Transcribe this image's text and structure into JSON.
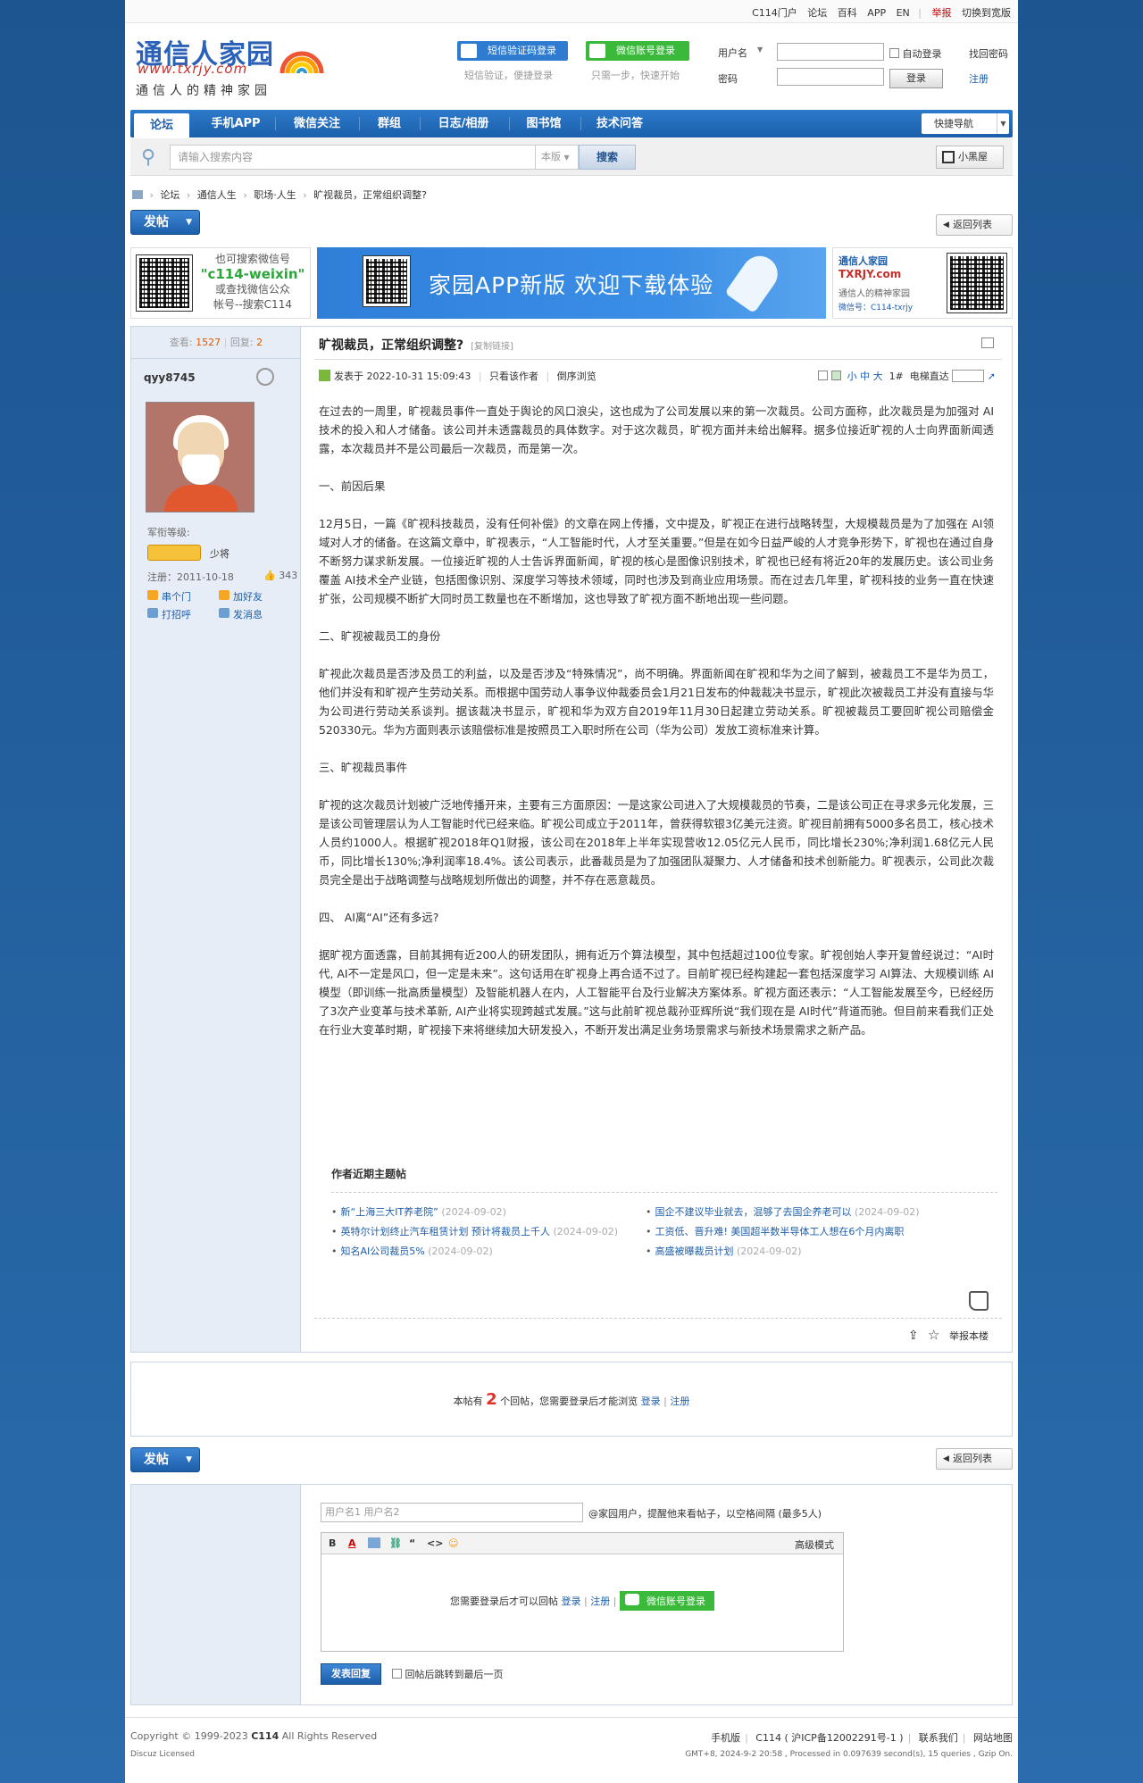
{
  "topbar": {
    "links": [
      "C114门户",
      "论坛",
      "百科",
      "APP",
      "EN"
    ],
    "report": "举报",
    "switch_width": "切换到宽版"
  },
  "header": {
    "logo_title": "通信人家园",
    "logo_url": "www.txrjy.com",
    "logo_slogan": "通信人的精神家园",
    "sms_login": "短信验证码登录",
    "sms_hint": "短信验证，便捷登录",
    "wechat_login": "微信账号登录",
    "wechat_hint": "只需一步，快速开始",
    "username_label": "用户名",
    "password_label": "密码",
    "auto_login": "自动登录",
    "find_password": "找回密码",
    "login_button": "登录",
    "register": "注册"
  },
  "nav": {
    "items": [
      "论坛",
      "手机APP",
      "微信关注",
      "群组",
      "日志/相册",
      "图书馆",
      "技术问答"
    ],
    "quick_nav": "快捷导航"
  },
  "search": {
    "placeholder": "请输入搜索内容",
    "scope": "本版",
    "button": "搜索",
    "black_room": "小黑屋"
  },
  "breadcrumb": [
    "论坛",
    "通信人生",
    "职场·人生",
    "旷视裁员，正常组织调整?"
  ],
  "actions": {
    "post": "发帖",
    "back_to_list": "返回列表"
  },
  "banner": {
    "wx_line1": "也可搜索微信号",
    "wx_id": "\"c114-weixin\"",
    "wx_line3": "或查找微信公众",
    "wx_line4": "帐号--搜索C114",
    "app_text": "家园APP新版 欢迎下载体验",
    "right_title": "通信人家园",
    "right_brand": "TXRJY.com",
    "right_slogan": "通信人的精神家园",
    "right_wechat": "微信号：C114-txrjy"
  },
  "post": {
    "views_label": "查看:",
    "views": "1527",
    "replies_label": "回复:",
    "replies": "2",
    "title": "旷视裁员，正常组织调整?",
    "copy_link": "[复制链接]",
    "author": "qyy8745",
    "rank_label": "军衔等级:",
    "rank": "少将",
    "reg_date": "注册：2011-10-18",
    "likes": "343",
    "user_actions": [
      "串个门",
      "加好友",
      "打招呼",
      "发消息"
    ],
    "posted_at": "发表于 2022-10-31 15:09:43",
    "only_author": "只看该作者",
    "reverse": "倒序浏览",
    "font_sizes": [
      "小",
      "中",
      "大"
    ],
    "floor": "1#",
    "elevator": "电梯直达",
    "paragraphs": [
      "在过去的一周里，旷视裁员事件一直处于舆论的风口浪尖，这也成为了公司发展以来的第一次裁员。公司方面称，此次裁员是为加强对 AI技术的投入和人才储备。该公司并未透露裁员的具体数字。对于这次裁员，旷视方面并未给出解释。据多位接近旷视的人士向界面新闻透露，本次裁员并不是公司最后一次裁员，而是第一次。",
      "一、前因后果",
      "12月5日，一篇《旷视科技裁员，没有任何补偿》的文章在网上传播，文中提及，旷视正在进行战略转型，大规模裁员是为了加强在 AI领域对人才的储备。在这篇文章中，旷视表示，“人工智能时代，人才至关重要。”但是在如今日益严峻的人才竞争形势下，旷视也在通过自身不断努力谋求新发展。一位接近旷视的人士告诉界面新闻，旷视的核心是图像识别技术，旷视也已经有将近20年的发展历史。该公司业务覆盖 AI技术全产业链，包括图像识别、深度学习等技术领域，同时也涉及到商业应用场景。而在过去几年里，旷视科技的业务一直在快速扩张，公司规模不断扩大同时员工数量也在不断增加，这也导致了旷视方面不断地出现一些问题。",
      "二、旷视被裁员工的身份",
      "旷视此次裁员是否涉及员工的利益，以及是否涉及“特殊情况”，尚不明确。界面新闻在旷视和华为之间了解到，被裁员工不是华为员工，他们并没有和旷视产生劳动关系。而根据中国劳动人事争议仲裁委员会1月21日发布的仲裁裁决书显示，旷视此次被裁员工并没有直接与华为公司进行劳动关系谈判。据该裁决书显示，旷视和华为双方自2019年11月30日起建立劳动关系。旷视被裁员工要回旷视公司赔偿金520330元。华为方面则表示该赔偿标准是按照员工入职时所在公司（华为公司）发放工资标准来计算。",
      "三、旷视裁员事件",
      "旷视的这次裁员计划被广泛地传播开来，主要有三方面原因：一是这家公司进入了大规模裁员的节奏，二是该公司正在寻求多元化发展，三是该公司管理层认为人工智能时代已经来临。旷视公司成立于2011年，曾获得软银3亿美元注资。旷视目前拥有5000多名员工，核心技术人员约1000人。根据旷视2018年Q1财报，该公司在2018年上半年实现营收12.05亿元人民币，同比增长230%;净利润1.68亿元人民币，同比增长130%;净利润率18.4%。该公司表示，此番裁员是为了加强团队凝聚力、人才储备和技术创新能力。旷视表示，公司此次裁员完全是出于战略调整与战略规划所做出的调整，并不存在恶意裁员。",
      "四、 AI离“AI”还有多远?",
      "据旷视方面透露，目前其拥有近200人的研发团队，拥有近万个算法模型，其中包括超过100位专家。旷视创始人李开复曾经说过：“AI时代, AI不一定是风口，但一定是未来”。这句话用在旷视身上再合适不过了。目前旷视已经构建起一套包括深度学习 AI算法、大规模训练 AI模型（即训练一批高质量模型）及智能机器人在内，人工智能平台及行业解决方案体系。旷视方面还表示：“人工智能发展至今，已经经历了3次产业变革与技术革新, AI产业将实现跨越式发展。”这与此前旷视总裁孙亚辉所说“我们现在是 AI时代”背道而驰。但目前来看我们正处在行业大变革时期，旷视接下来将继续加大研发投入，不断开发出满足业务场景需求与新技术场景需求之新产品。"
    ],
    "recent_title": "作者近期主题帖",
    "recent_left": [
      {
        "title": "新“上海三大IT养老院”",
        "date": "(2024-09-02)"
      },
      {
        "title": "英特尔计划终止汽车租赁计划 预计将裁员上千人",
        "date": "(2024-09-02)"
      },
      {
        "title": "知名AI公司裁员5%",
        "date": "(2024-09-02)"
      }
    ],
    "recent_right": [
      {
        "title": "国企不建议毕业就去，混够了去国企养老可以",
        "date": "(2024-09-02)"
      },
      {
        "title": "工资低、晋升难! 美国超半数半导体工人想在6个月内离职",
        "date": ""
      },
      {
        "title": "高盛被曝裁员计划",
        "date": "(2024-09-02)"
      }
    ],
    "report": "举报本楼"
  },
  "reply_notice": {
    "prefix": "本帖有",
    "count": "2",
    "suffix": "个回帖，您需要登录后才能浏览",
    "login": "登录",
    "register": "注册"
  },
  "reply": {
    "at_placeholder": "用户名1 用户名2",
    "at_hint": "@家园用户，提醒他来看帖子，以空格间隔 (最多5人)",
    "advanced": "高级模式",
    "need_login": "您需要登录后才可以回帖",
    "login": "登录",
    "register": "注册",
    "wechat_login": "微信账号登录",
    "submit": "发表回复",
    "jump_last": "回帖后跳转到最后一页"
  },
  "footer": {
    "copyright": "Copyright © 1999-2023",
    "brand": "C114",
    "rights": "All Rights Reserved",
    "license": "Discuz Licensed",
    "mobile": "手机版",
    "icp": "C114 ( 沪ICP备12002291号-1 )",
    "contact": "联系我们",
    "sitemap": "网站地图",
    "gmt": "GMT+8, 2024-9-2 20:58 , Processed in 0.097639 second(s), 15 queries , Gzip On."
  },
  "colors": {
    "brand_blue": "#1e5ea9",
    "wechat_green": "#3bb93b",
    "accent_red": "#e0322b"
  }
}
